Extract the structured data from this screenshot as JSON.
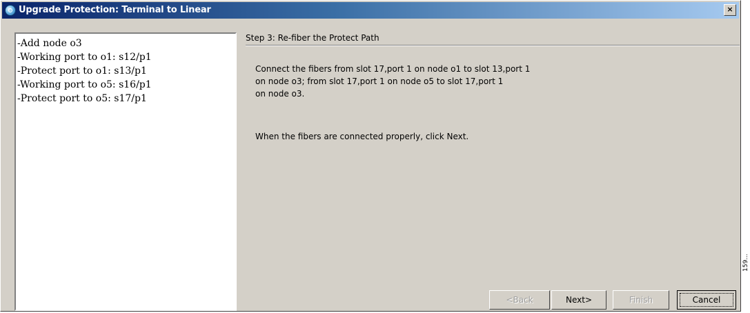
{
  "window": {
    "title": "Upgrade Protection: Terminal to Linear",
    "close_label": "×"
  },
  "left_panel": {
    "lines": [
      "-Add node o3",
      "-Working port to o1: s12/p1",
      "-Protect port to o1: s13/p1",
      "-Working port to o5: s16/p1",
      "-Protect port to o5: s17/p1"
    ]
  },
  "step": {
    "title": "Step 3: Re-fiber the Protect Path",
    "instructions": [
      "Connect the fibers from slot 17,port 1 on node o1 to slot 13,port 1",
      "on node o3; from slot 17,port 1 on node o5 to slot 17,port 1",
      "on node o3."
    ],
    "hint": "When the fibers are connected properly, click Next."
  },
  "buttons": {
    "back": "<Back",
    "next": "Next>",
    "finish": "Finish",
    "cancel": "Cancel"
  },
  "side_mark": "159..."
}
